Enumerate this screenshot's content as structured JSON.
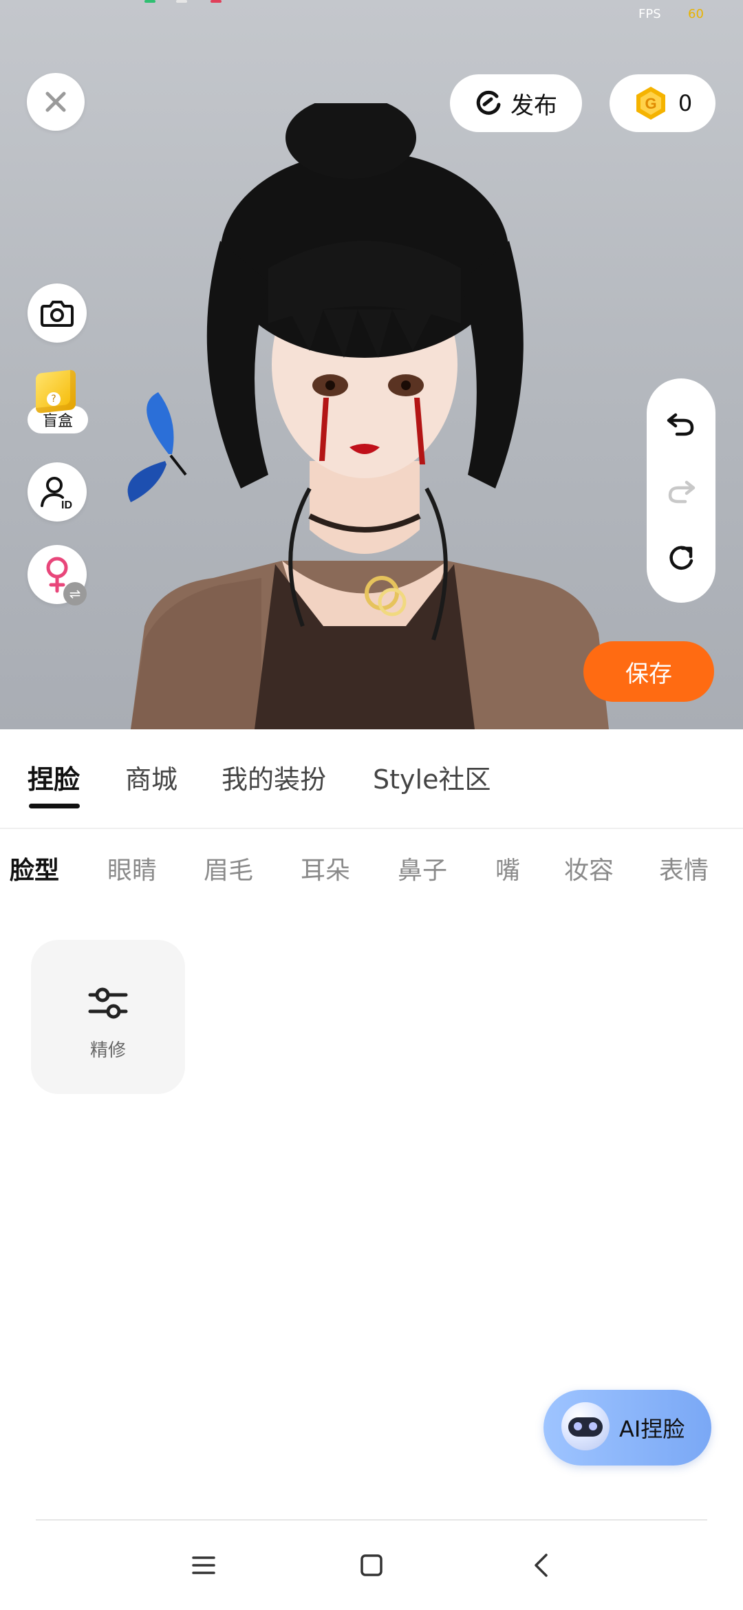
{
  "status": {
    "fps_label": "FPS",
    "fps_value": "60"
  },
  "header": {
    "publish_label": "发布",
    "coin_count": "0"
  },
  "left_tools": {
    "blindbox_label": "盲盒"
  },
  "actions": {
    "save_label": "保存"
  },
  "main_tabs": [
    {
      "label": "捏脸",
      "active": true
    },
    {
      "label": "商城",
      "active": false
    },
    {
      "label": "我的装扮",
      "active": false
    },
    {
      "label": "Style社区",
      "active": false
    }
  ],
  "sub_tabs": [
    {
      "label": "脸型",
      "active": true
    },
    {
      "label": "眼睛",
      "active": false
    },
    {
      "label": "眉毛",
      "active": false
    },
    {
      "label": "耳朵",
      "active": false
    },
    {
      "label": "鼻子",
      "active": false
    },
    {
      "label": "嘴",
      "active": false
    },
    {
      "label": "妆容",
      "active": false
    },
    {
      "label": "表情",
      "active": false
    }
  ],
  "tools": [
    {
      "label": "精修",
      "icon": "sliders-icon"
    }
  ],
  "ai_button": {
    "label": "AI捏脸"
  },
  "colors": {
    "accent": "#ff6b12",
    "coin": "#f5b300",
    "gender": "#e8467a",
    "ai_gradient_start": "#9ec4ff",
    "ai_gradient_end": "#7aa8f5"
  }
}
